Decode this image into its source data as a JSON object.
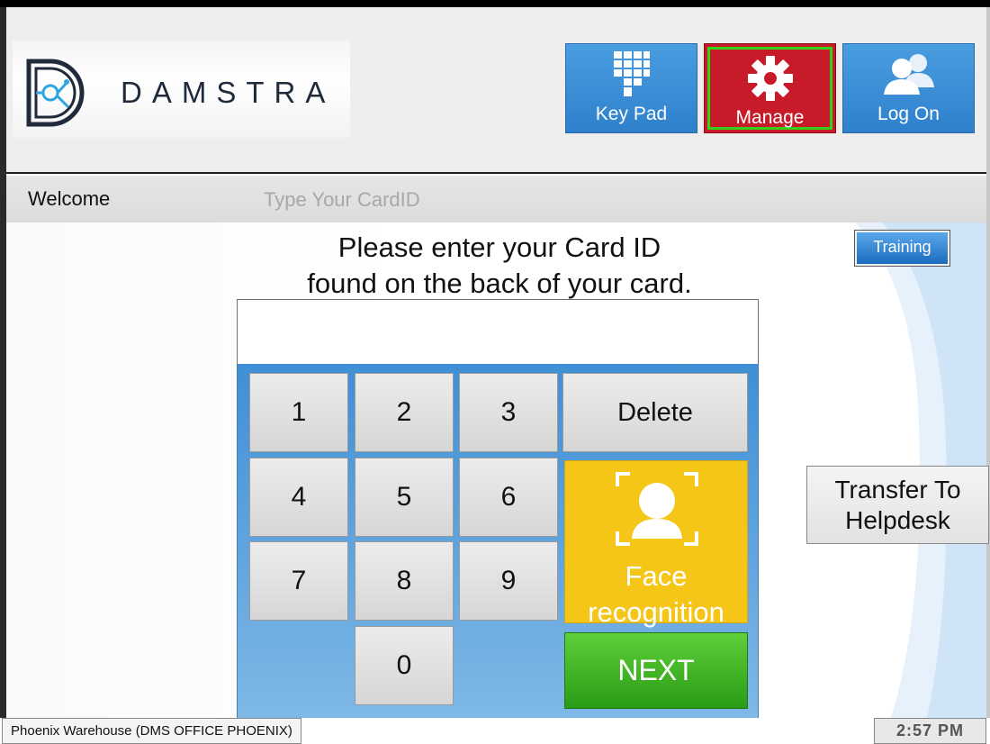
{
  "header": {
    "logo_text": "DAMSTRA",
    "buttons": [
      {
        "label": "Key Pad",
        "icon": "keypad-icon"
      },
      {
        "label": "Manage",
        "icon": "gear-icon"
      },
      {
        "label": "Log On",
        "icon": "users-icon"
      }
    ]
  },
  "welcome_bar": {
    "welcome_label": "Welcome",
    "hint": "Type Your CardID"
  },
  "main": {
    "prompt_line1": "Please enter your Card ID",
    "prompt_line2": "found on the back of your card.",
    "training_label": "Training",
    "card_input_value": "",
    "keys": [
      "1",
      "2",
      "3",
      "4",
      "5",
      "6",
      "7",
      "8",
      "9",
      "0"
    ],
    "delete_label": "Delete",
    "face_label_line1": "Face",
    "face_label_line2": "recognition",
    "next_label": "NEXT",
    "helpdesk_line1": "Transfer To",
    "helpdesk_line2": "Helpdesk"
  },
  "status": {
    "location": "Phoenix Warehouse (DMS OFFICE PHOENIX)",
    "time": "2:57 PM"
  },
  "colors": {
    "header_button_blue": "#2e80cc",
    "manage_red": "#c81b2a",
    "manage_highlight": "#33d11a",
    "face_yellow": "#f5c518",
    "next_green": "#2a9b16",
    "keypad_blue": "#3f8fd6"
  }
}
